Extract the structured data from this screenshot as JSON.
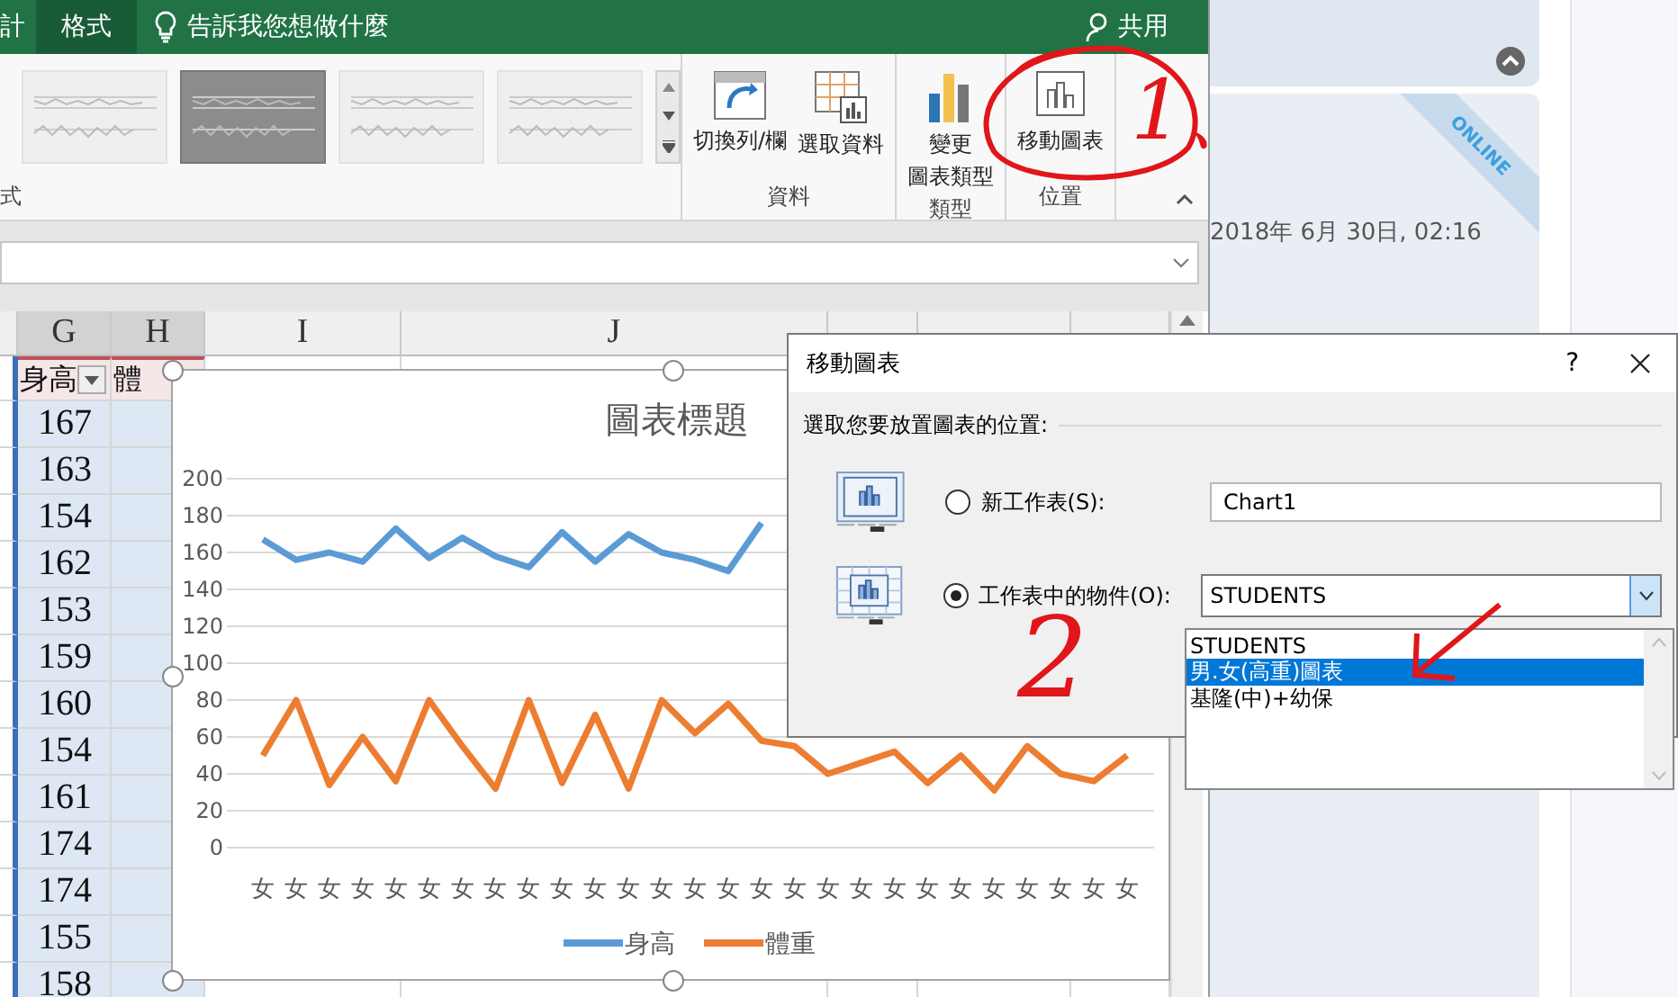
{
  "excel": {
    "ribbon_tabs": [
      {
        "label": "計",
        "selected": false
      },
      {
        "label": "格式",
        "selected": true
      }
    ],
    "tell_me": "告訴我您想做什麼",
    "share": "共用",
    "chart_styles": [
      {
        "selected": false
      },
      {
        "selected": true
      },
      {
        "selected": false
      },
      {
        "selected": false
      }
    ],
    "style_group_label": "式",
    "groups": [
      {
        "label": "資料",
        "buttons": [
          {
            "kind": "switch",
            "label": "切換列/欄"
          },
          {
            "kind": "select",
            "label": "選取資料"
          }
        ]
      },
      {
        "label": "類型",
        "buttons": [
          {
            "kind": "change",
            "lines": [
              "變更",
              "圖表類型"
            ]
          }
        ]
      },
      {
        "label": "位置",
        "buttons": [
          {
            "kind": "move",
            "label": "移動圖表"
          }
        ]
      }
    ],
    "sheet": {
      "columns": [
        "G",
        "H",
        "I",
        "J"
      ],
      "header_cells": [
        "身高",
        "體"
      ],
      "height_values": [
        "167",
        "163",
        "154",
        "162",
        "153",
        "159",
        "160",
        "154",
        "161",
        "174",
        "174",
        "155",
        "158"
      ]
    }
  },
  "chart": {
    "chart_data": {
      "type": "line",
      "title": "圖表標題",
      "categories": [
        "女",
        "女",
        "女",
        "女",
        "女",
        "女",
        "女",
        "女",
        "女",
        "女",
        "女",
        "女",
        "女",
        "女",
        "女",
        "女",
        "女",
        "女",
        "女",
        "女",
        "女",
        "女",
        "女",
        "女",
        "女",
        "女",
        "女"
      ],
      "series": [
        {
          "name": "身高",
          "color": "#5b9bd5",
          "values": [
            167,
            156,
            160,
            155,
            173,
            157,
            168,
            158,
            152,
            171,
            155,
            170,
            160,
            156,
            150,
            176,
            null,
            null,
            null,
            null,
            null,
            null,
            null,
            null,
            null,
            null,
            null
          ]
        },
        {
          "name": "體重",
          "color": "#ed7d31",
          "values": [
            50,
            80,
            34,
            60,
            36,
            80,
            55,
            32,
            80,
            35,
            72,
            32,
            80,
            62,
            78,
            58,
            55,
            40,
            46,
            52,
            35,
            50,
            31,
            55,
            40,
            36,
            50
          ]
        }
      ],
      "ylim": [
        0,
        200
      ],
      "grid": true,
      "legend": "bottom",
      "yticks": [
        0,
        20,
        40,
        60,
        80,
        100,
        120,
        140,
        160,
        180,
        200
      ]
    }
  },
  "dialog": {
    "title": "移動圖表",
    "help": "?",
    "prompt": "選取您要放置圖表的位置:",
    "options": [
      {
        "kind": "text",
        "label": "新工作表(S):",
        "selected": false,
        "value": "Chart1"
      },
      {
        "kind": "combo",
        "label": "工作表中的物件(O):",
        "selected": true,
        "value": "STUDENTS"
      }
    ],
    "list": [
      {
        "label": "STUDENTS",
        "selected": false
      },
      {
        "label": "男.女(高重)圖表",
        "selected": true
      },
      {
        "label": "基隆(中)+幼保",
        "selected": false
      }
    ]
  },
  "side_panel": {
    "badge": "ONLINE",
    "timestamp": "2018年 6月 30日, 02:16"
  },
  "annotations": [
    {
      "text": "1、"
    },
    {
      "text": "2"
    }
  ]
}
